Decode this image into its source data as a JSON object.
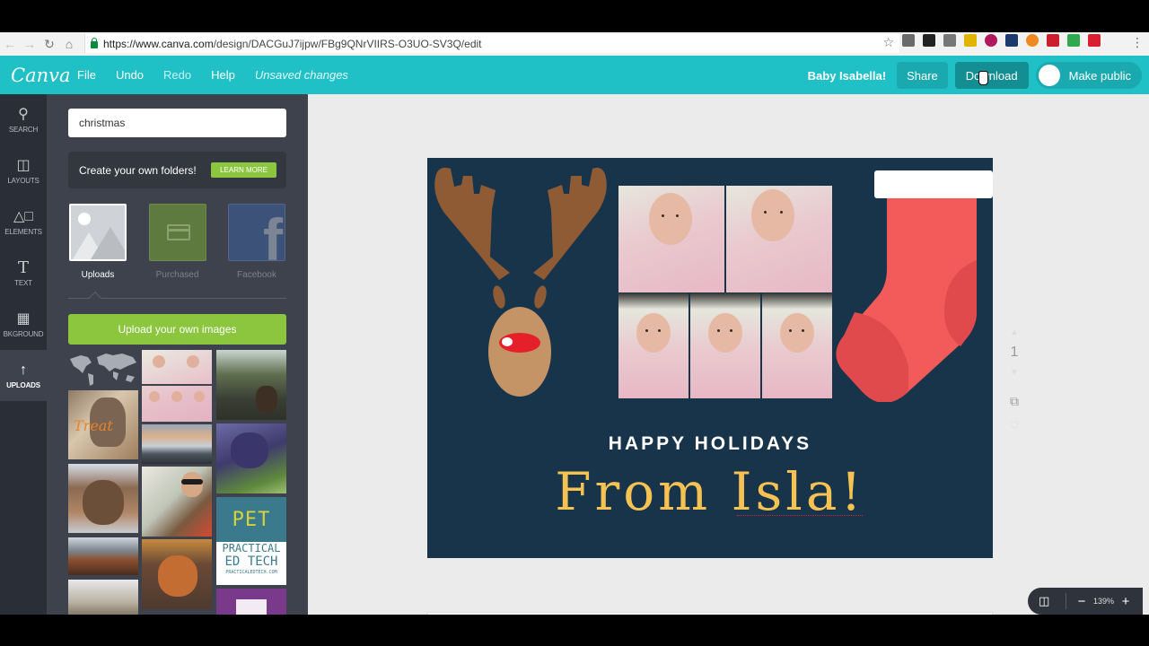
{
  "browser": {
    "url_host": "https://www.canva.com",
    "url_path": "/design/DACGuJ7ijpw/FBg9QNrVIIRS-O3UO-SV3Q/edit",
    "extensions": [
      "cast",
      "owl",
      "lightbulb",
      "bars",
      "tube",
      "n-notebook",
      "h-circle",
      "pin-7",
      "drive",
      "video"
    ],
    "extension_colors": [
      "#6a6a6a",
      "#222222",
      "#777777",
      "#e0b400",
      "#b3165e",
      "#1c3a6e",
      "#f08a20",
      "#cc1f2b",
      "#2fa84f",
      "#d82030"
    ]
  },
  "topbar": {
    "logo": "Canva",
    "menu": [
      {
        "label": "File"
      },
      {
        "label": "Undo"
      },
      {
        "label": "Redo"
      },
      {
        "label": "Help"
      }
    ],
    "status": "Unsaved changes",
    "design_name": "Baby Isabella!",
    "share_label": "Share",
    "download_label": "Download",
    "public_label": "Make public"
  },
  "sidebar": {
    "items": [
      {
        "label": "SEARCH",
        "icon": "search-icon"
      },
      {
        "label": "LAYOUTS",
        "icon": "layouts-icon"
      },
      {
        "label": "ELEMENTS",
        "icon": "elements-icon"
      },
      {
        "label": "TEXT",
        "icon": "text-icon"
      },
      {
        "label": "BKGROUND",
        "icon": "background-icon"
      },
      {
        "label": "UPLOADS",
        "icon": "upload-arrow-icon"
      }
    ],
    "active": "UPLOADS"
  },
  "panel": {
    "search_value": "christmas",
    "promo_text": "Create your own folders!",
    "learn_more": "LEARN MORE",
    "folders": [
      {
        "label": "Uploads",
        "active": true
      },
      {
        "label": "Purchased",
        "active": false
      },
      {
        "label": "Facebook",
        "active": false
      }
    ],
    "upload_button": "Upload your own images",
    "thumbnails": [
      "world-map",
      "baby-collage",
      "dog-bridge",
      "dog-treat-please",
      "lake-sunset",
      "dog-purple",
      "dog-porch",
      "man-sunglasses-dog",
      "practical-ed-tech-logo",
      "autumn-landscape",
      "dog-couch",
      "snow-scene",
      "onenote-logo"
    ],
    "pet_logo_top": "PET",
    "pet_logo_lines": [
      "PRACTICAL",
      "ED TECH",
      "PRACTICALEDTECH.COM"
    ]
  },
  "canvas": {
    "greeting": "HAPPY HOLIDAYS",
    "headline": "From Isla!",
    "page_number": "1",
    "zoom_level": "139%",
    "colors": {
      "background": "#17344b",
      "antler": "#8f5b35",
      "face": "#c59466",
      "nose": "#e5202a",
      "stocking": "#f35a5a",
      "stocking_shade": "#e04a4d",
      "headline": "#f6c352"
    }
  }
}
